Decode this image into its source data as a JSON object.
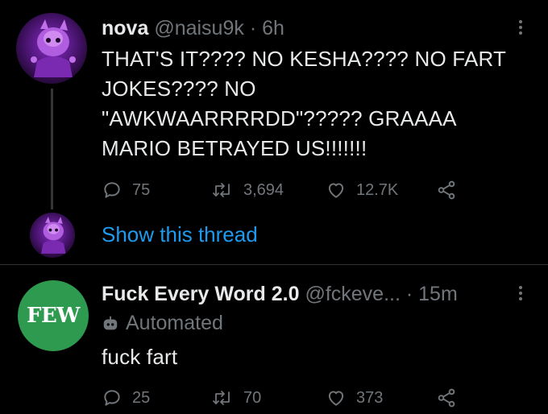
{
  "tweet1": {
    "name": "nova",
    "handle": "@naisu9k",
    "separator": "·",
    "time": "6h",
    "text_lines": [
      "THAT'S IT???? NO KESHA???? NO FART",
      "JOKES???? NO",
      "\"AWKWAARRRRDD\"????? GRAAAA",
      "MARIO BETRAYED US!!!!!!!"
    ],
    "replies": "75",
    "retweets": "3,694",
    "likes": "12.7K",
    "show_thread": "Show this thread"
  },
  "tweet2": {
    "name": "Fuck Every Word 2.0",
    "handle": "@fckeve...",
    "separator": "·",
    "time": "15m",
    "avatar_text": "FEW",
    "automated_label": "Automated",
    "text": "fuck fart",
    "replies": "25",
    "retweets": "70",
    "likes": "373"
  },
  "colors": {
    "background": "#000000",
    "text": "#e7e9ea",
    "muted": "#71767b",
    "link": "#1d9bf0",
    "few_green": "#2e9a4f"
  },
  "icons": [
    "more-icon",
    "reply-icon",
    "retweet-icon",
    "like-icon",
    "share-icon",
    "bot-icon"
  ]
}
